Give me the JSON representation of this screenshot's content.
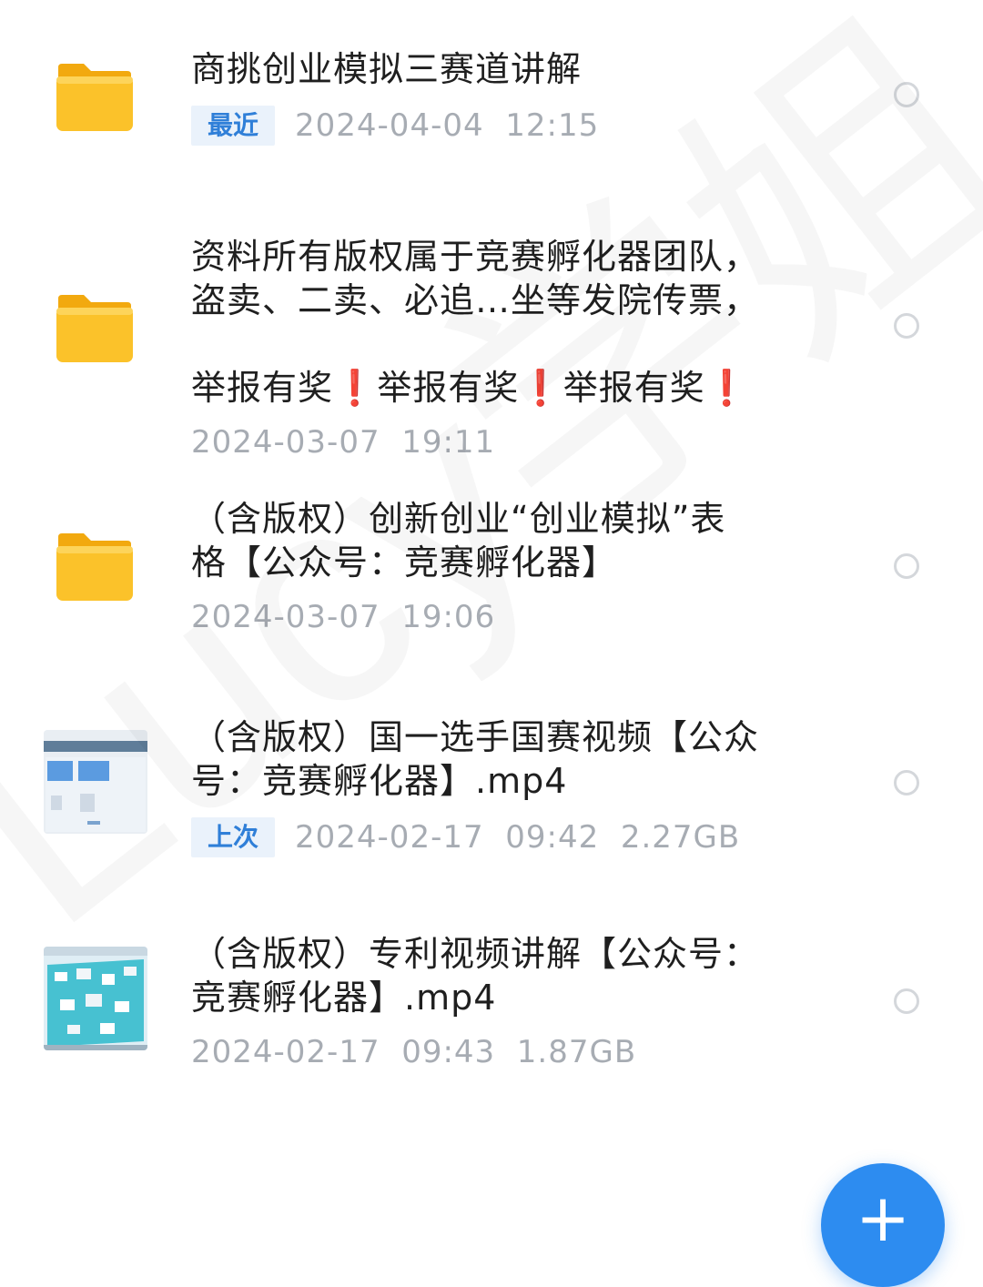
{
  "files": [
    {
      "name": "商挑创业模拟三赛道讲解",
      "tag": "最近",
      "meta": "2024-04-04  12:15",
      "type_icon": "folder-icon"
    },
    {
      "name_line1": "资料所有版权属于竞赛孵化器团队，",
      "name_line2": "盗卖、二卖、必追…坐等发院传票，",
      "name_line3_part": "举报有奖",
      "bang": "❗",
      "meta": "2024-03-07  19:11",
      "type_icon": "folder-icon"
    },
    {
      "name": "（含版权）创新创业“创业模拟”表\n格【公众号：竞赛孵化器】",
      "meta": "2024-03-07  19:06",
      "type_icon": "folder-icon"
    },
    {
      "name": "（含版权）国一选手国赛视频【公众\n号：竞赛孵化器】.mp4",
      "tag": "上次",
      "meta": "2024-02-17  09:42  2.27GB",
      "type_icon": "video-thumbnail"
    },
    {
      "name": "（含版权）专利视频讲解【公众号：\n竞赛孵化器】.mp4",
      "meta": "2024-02-17  09:43  1.87GB",
      "type_icon": "video-thumbnail"
    }
  ],
  "watermark": "Lucy学姐",
  "fab_label": "+",
  "colors": {
    "accent": "#2d8cf0",
    "tag_text": "#2f7fd8",
    "folder": "#f7b81e",
    "meta": "#a7acb3"
  }
}
